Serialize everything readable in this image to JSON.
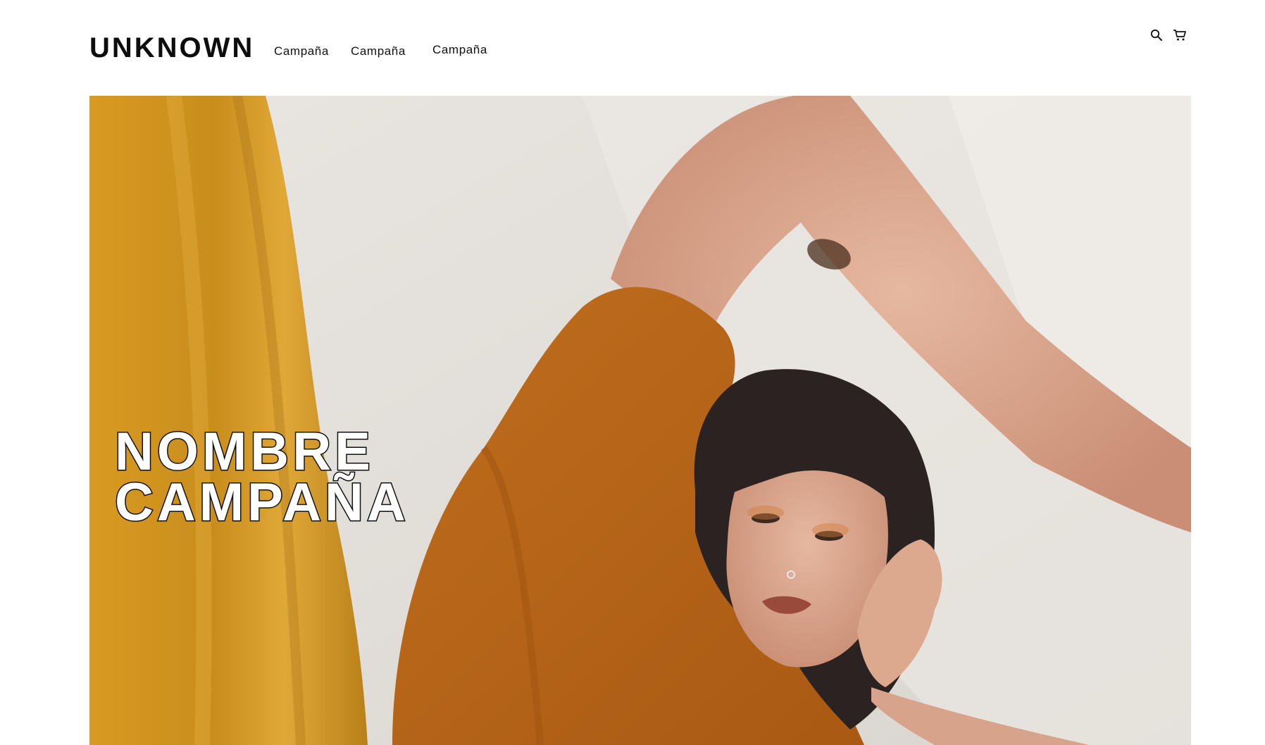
{
  "brand": {
    "logo": "UNKNOWN"
  },
  "nav": {
    "items": [
      {
        "label": "Campaña"
      },
      {
        "label": "Campaña"
      },
      {
        "label": "Campaña"
      }
    ]
  },
  "header_icons": {
    "search": "search-icon",
    "cart": "cart-icon"
  },
  "hero": {
    "title_line1": "NOMBRE",
    "title_line2": "CAMPAÑA",
    "image": "campaign-photo"
  },
  "colors": {
    "mustard_fabric": "#c9921f",
    "rust_shirt": "#b8651c",
    "background_wall": "#e7e3de",
    "text": "#111111"
  }
}
